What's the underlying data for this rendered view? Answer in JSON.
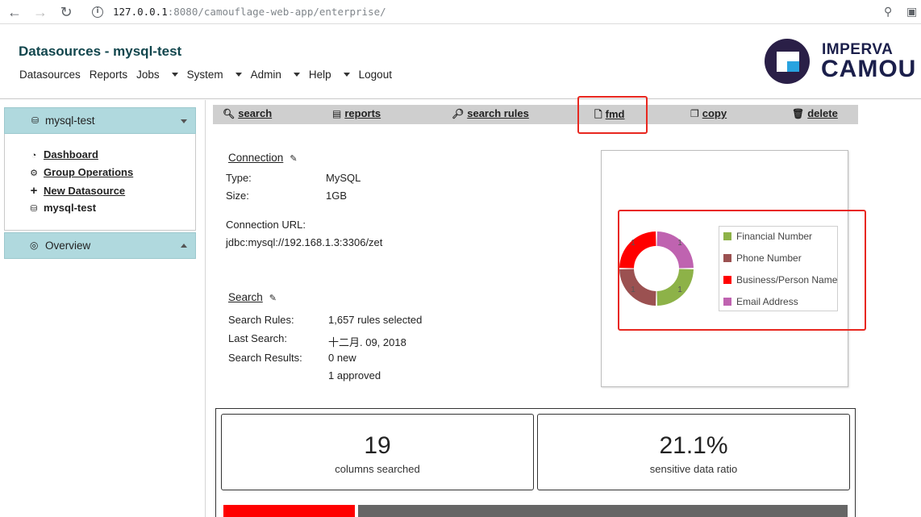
{
  "browser": {
    "url_host": "127.0.0.1",
    "url_rest": ":8080/camouflage-web-app/enterprise/"
  },
  "header": {
    "title": "Datasources - mysql-test",
    "menu": [
      "Datasources",
      "Reports",
      "Jobs",
      "System",
      "Admin",
      "Help",
      "Logout"
    ],
    "logo_line1": "IMPERVA",
    "logo_line2": "CAMOU"
  },
  "sidebar": {
    "datasource": "mysql-test",
    "items": [
      "Dashboard",
      "Group Operations",
      "New Datasource",
      "mysql-test"
    ],
    "overview": "Overview"
  },
  "toolbar": {
    "search": "search",
    "reports": "reports",
    "search_rules": "search rules",
    "fmd": "fmd",
    "copy": "copy",
    "delete": "delete"
  },
  "connection": {
    "title": "Connection",
    "type_label": "Type:",
    "type_value": "MySQL",
    "size_label": "Size:",
    "size_value": "1GB",
    "url_label": "Connection URL:",
    "url_value": "jdbc:mysql://192.168.1.3:3306/zet"
  },
  "search": {
    "title": "Search",
    "rules_label": "Search Rules:",
    "rules_value": "1,657 rules selected",
    "last_label": "Last Search:",
    "last_value": "十二月. 09, 2018",
    "results_label": "Search Results:",
    "results_new": "0 new",
    "results_approved": "1 approved"
  },
  "chart_data": {
    "type": "pie",
    "donut": true,
    "categories": [
      "Financial Number",
      "Phone Number",
      "Business/Person Name",
      "Email Address"
    ],
    "values": [
      1,
      1,
      1,
      1
    ],
    "colors": [
      "#8db248",
      "#9b5151",
      "#ff0000",
      "#bf63b0"
    ],
    "legend": "right"
  },
  "stats": {
    "columns_value": "19",
    "columns_label": "columns searched",
    "ratio_value": "21.1%",
    "ratio_label": "sensitive data ratio",
    "ratio_fraction": 0.211
  }
}
